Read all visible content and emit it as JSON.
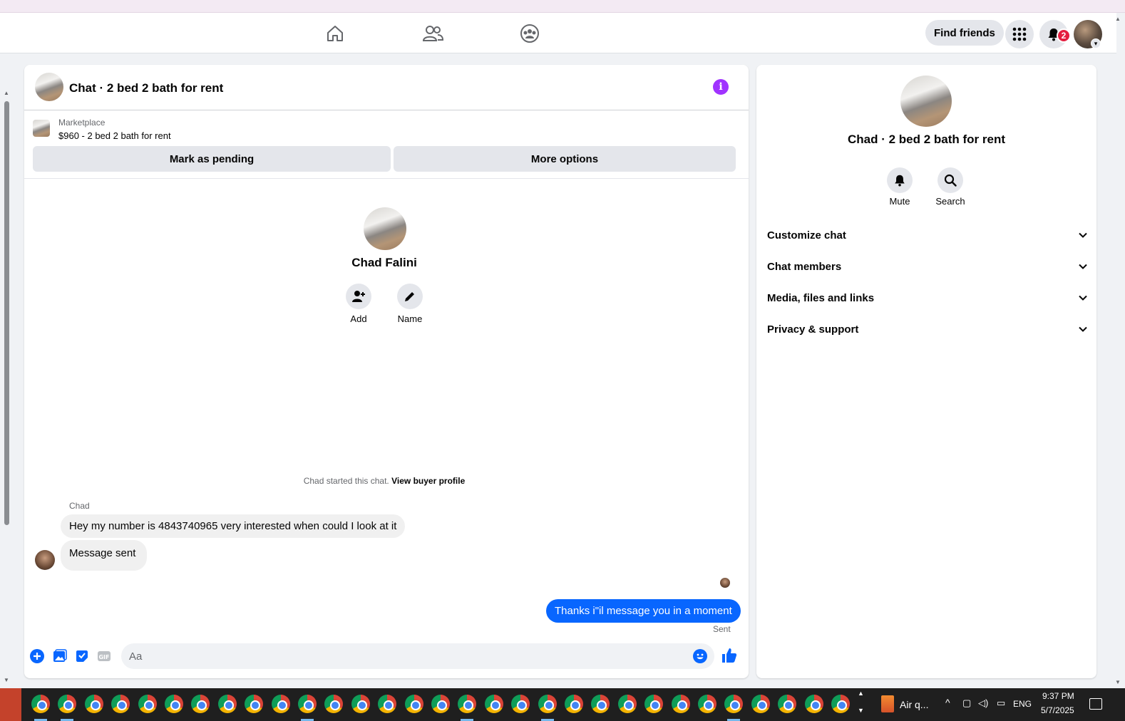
{
  "topnav": {
    "find_friends": "Find friends",
    "notification_count": "2"
  },
  "chat": {
    "title": "Chat · 2 bed 2 bath for rent",
    "listing": {
      "source": "Marketplace",
      "summary": "$960 - 2 bed 2 bath for rent",
      "mark_pending": "Mark as pending",
      "more_options": "More options"
    },
    "profile": {
      "name": "Chad Falini",
      "add_label": "Add",
      "name_label": "Name"
    },
    "started_text": "Chad started this chat.",
    "view_buyer_profile": "View buyer profile",
    "messages": {
      "sender": "Chad",
      "incoming_1": "Hey my number is 4843740965 very interested when could I look at it",
      "incoming_2": "Message sent",
      "outgoing_1": "Thanks i\"il message you in a moment",
      "status": "Sent"
    },
    "composer": {
      "placeholder": "Aa"
    }
  },
  "info": {
    "title": "Chad · 2 bed 2 bath for rent",
    "mute_label": "Mute",
    "search_label": "Search",
    "sections": [
      "Customize chat",
      "Chat members",
      "Media, files and links",
      "Privacy & support"
    ]
  },
  "taskbar": {
    "weather": "Air q...",
    "language": "ENG",
    "time": "9:37 PM",
    "date": "5/7/2025"
  },
  "colors": {
    "accent": "#0866ff",
    "info_icon": "#a033ff",
    "badge": "#e41e3f"
  }
}
